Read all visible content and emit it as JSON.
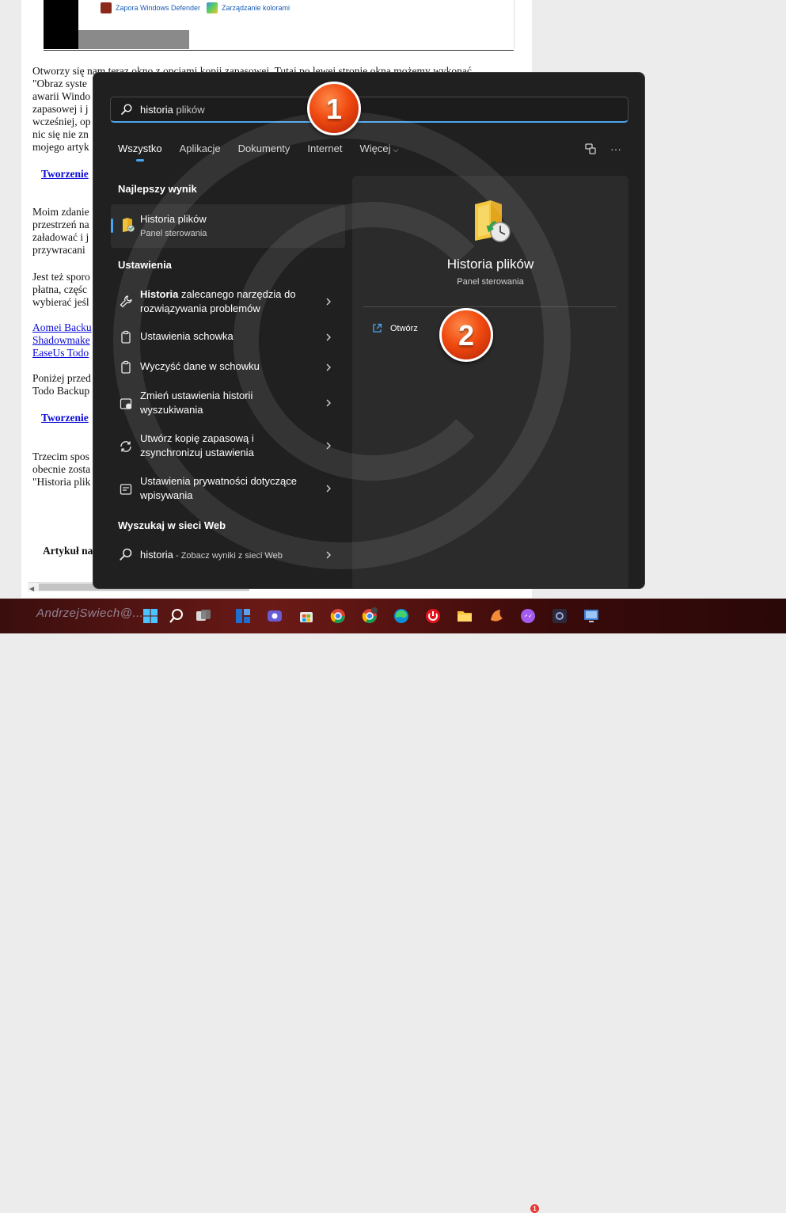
{
  "background_page": {
    "control_panel_items": [
      "Zapora Windows Defender",
      "Zarządzanie kolorami"
    ],
    "paragraph1": [
      "Otworzy się nam teraz okno z opcjami kopii zapasowej. Tutaj po lewej stronie okna możemy wykonać",
      "\"Obraz syste",
      "awarii Windo",
      "zapasowej i j",
      "wcześniej, op",
      "nic się nie zn",
      "mojego artyk"
    ],
    "link1": "Tworzenie",
    "paragraph2": [
      "Moim zdanie",
      "przestrzeń na",
      "załadować i j",
      "przywracani"
    ],
    "paragraph3": [
      "Jest też sporo",
      "płatna, częśc",
      "wybierać jeśl"
    ],
    "links": [
      "Aomei Backu",
      "Shadowmake",
      "EaseUs Todo"
    ],
    "paragraph4": [
      "Poniżej przed",
      "Todo Backup"
    ],
    "link2": "Tworzenie",
    "paragraph5": [
      "Trzecim spos",
      "obecnie zosta",
      "\"Historia plik"
    ],
    "article_label": "Artykuł na"
  },
  "search": {
    "query_bold": "historia",
    "query_rest": "plików",
    "value": "historia plików",
    "callout1": "1",
    "callout2": "2"
  },
  "tabs": [
    {
      "label": "Wszystko",
      "active": true
    },
    {
      "label": "Aplikacje"
    },
    {
      "label": "Dokumenty"
    },
    {
      "label": "Internet"
    },
    {
      "label": "Więcej"
    }
  ],
  "toolbar_icons": [
    "share-device-icon",
    "more-options-icon"
  ],
  "best_match": {
    "section": "Najlepszy wynik",
    "title": "Historia plików",
    "subtitle": "Panel sterowania"
  },
  "settings": {
    "section": "Ustawienia",
    "items": [
      {
        "icon": "wrench-icon",
        "bold": "Historia",
        "line1_rest": " zalecanego narzędzia do",
        "line2": "rozwiązywania problemów"
      },
      {
        "icon": "clipboard-icon",
        "line1": "Ustawienia schowka"
      },
      {
        "icon": "clipboard-clear-icon",
        "line1": "Wyczyść dane w schowku"
      },
      {
        "icon": "history-settings-icon",
        "line1": "Zmień ustawienia historii",
        "line2": "wyszukiwania"
      },
      {
        "icon": "sync-icon",
        "line1": "Utwórz kopię zapasową i",
        "line2": "zsynchronizuj ustawienia"
      },
      {
        "icon": "typing-privacy-icon",
        "line1": "Ustawienia prywatności dotyczące",
        "line2": "wpisywania"
      }
    ]
  },
  "web": {
    "section": "Wyszukaj w sieci Web",
    "query": "historia",
    "hint": " - Zobacz wyniki z sieci Web"
  },
  "preview": {
    "title": "Historia plików",
    "subtitle": "Panel sterowania",
    "action": "Otwórz"
  },
  "taskbar": {
    "author": "AndrzejSwiech@...",
    "notification_count": "1",
    "icons": [
      "start-icon",
      "widgets-icon",
      "teams-icon",
      "store-icon",
      "chrome-icon",
      "chrome-profile-icon",
      "edge-icon",
      "opera-icon",
      "file-explorer-icon",
      "app-icon",
      "messenger-icon",
      "settings-icon",
      "control-panel-icon"
    ]
  },
  "colors": {
    "panel_bg": "#202020",
    "accent": "#4aa6f0",
    "callout": "#f04a10"
  }
}
